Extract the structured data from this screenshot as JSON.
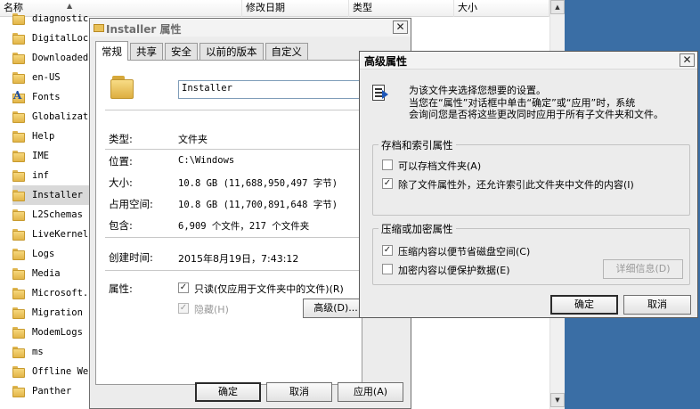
{
  "explorer": {
    "columns": [
      "名称",
      "修改日期",
      "类型",
      "大小"
    ],
    "files": [
      {
        "name": "diagnostic",
        "icon": "folder-icon"
      },
      {
        "name": "DigitalLoc",
        "icon": "folder-icon"
      },
      {
        "name": "Downloaded",
        "icon": "folder-icon"
      },
      {
        "name": "en-US",
        "icon": "folder-icon"
      },
      {
        "name": "Fonts",
        "icon": "fonts-folder-icon"
      },
      {
        "name": "Globalizat",
        "icon": "folder-icon"
      },
      {
        "name": "Help",
        "icon": "folder-icon"
      },
      {
        "name": "IME",
        "icon": "folder-icon"
      },
      {
        "name": "inf",
        "icon": "folder-icon"
      },
      {
        "name": "Installer",
        "icon": "folder-icon",
        "selected": true
      },
      {
        "name": "L2Schemas",
        "icon": "folder-icon"
      },
      {
        "name": "LiveKernel",
        "icon": "folder-icon"
      },
      {
        "name": "Logs",
        "icon": "folder-icon"
      },
      {
        "name": "Media",
        "icon": "folder-icon"
      },
      {
        "name": "Microsoft.",
        "icon": "folder-icon"
      },
      {
        "name": "Migration",
        "icon": "folder-icon"
      },
      {
        "name": "ModemLogs",
        "icon": "folder-icon"
      },
      {
        "name": "ms",
        "icon": "folder-icon"
      },
      {
        "name": "Offline We",
        "icon": "folder-icon"
      },
      {
        "name": "Panther",
        "icon": "folder-icon"
      }
    ]
  },
  "properties": {
    "title": "Installer 属性",
    "tabs": [
      "常规",
      "共享",
      "安全",
      "以前的版本",
      "自定义"
    ],
    "active_tab": 0,
    "folder_name": "Installer",
    "rows": [
      {
        "label": "类型:",
        "value": "文件夹"
      },
      {
        "label": "位置:",
        "value": "C:\\Windows"
      },
      {
        "label": "大小:",
        "value": "10.8 GB (11,688,950,497 字节)"
      },
      {
        "label": "占用空间:",
        "value": "10.8 GB (11,700,891,648 字节)"
      },
      {
        "label": "包含:",
        "value": "6,909 个文件，217 个文件夹"
      }
    ],
    "created_label": "创建时间:",
    "created_value": "2015年8月19日，7:43:12",
    "attributes_label": "属性:",
    "readonly_label": "只读(仅应用于文件夹中的文件)(R)",
    "hidden_label": "隐藏(H)",
    "advanced_button": "高级(D)...",
    "ok": "确定",
    "cancel": "取消",
    "apply": "应用(A)"
  },
  "advanced": {
    "title": "高级属性",
    "intro_line1": "为该文件夹选择您想要的设置。",
    "intro_line2": "当您在“属性”对话框中单击“确定”或“应用”时，系统",
    "intro_line3": "会询问您是否将这些更改同时应用于所有子文件夹和文件。",
    "archive_group": "存档和索引属性",
    "archive_label": "可以存档文件夹(A)",
    "archive_checked": false,
    "index_label": "除了文件属性外，还允许索引此文件夹中文件的内容(I)",
    "index_checked": true,
    "compress_group": "压缩或加密属性",
    "compress_label": "压缩内容以便节省磁盘空间(C)",
    "compress_checked": true,
    "encrypt_label": "加密内容以便保护数据(E)",
    "encrypt_checked": false,
    "details_button": "详细信息(D)",
    "ok": "确定",
    "cancel": "取消"
  }
}
